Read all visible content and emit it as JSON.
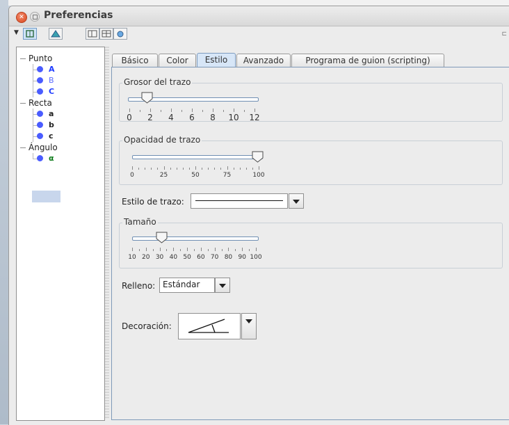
{
  "window": {
    "title": "Preferencias"
  },
  "tree": {
    "groups": [
      {
        "label": "Punto",
        "items": [
          {
            "label": "A",
            "color": "#1f3cff"
          },
          {
            "label": "B",
            "color": "#5b6bff"
          },
          {
            "label": "C",
            "color": "#1f3cff"
          }
        ]
      },
      {
        "label": "Recta",
        "items": [
          {
            "label": "a",
            "color": "#000000"
          },
          {
            "label": "b",
            "color": "#000000"
          },
          {
            "label": "c",
            "color": "#000000"
          }
        ]
      },
      {
        "label": "Ángulo",
        "items": [
          {
            "label": "α",
            "color": "#0a7a18"
          }
        ]
      }
    ],
    "selected": "α"
  },
  "tabs": [
    {
      "label": "Básico"
    },
    {
      "label": "Color"
    },
    {
      "label": "Estilo"
    },
    {
      "label": "Avanzado"
    },
    {
      "label": "Programa de guion (scripting)"
    }
  ],
  "active_tab": "Estilo",
  "style": {
    "thickness": {
      "title": "Grosor del trazo",
      "value": 2,
      "min": 0,
      "max": 12,
      "ticks": [
        "0",
        "2",
        "4",
        "6",
        "8",
        "10",
        "12"
      ]
    },
    "opacity": {
      "title": "Opacidad de trazo",
      "value": 100,
      "min": 0,
      "max": 100,
      "ticks": [
        "0",
        "25",
        "50",
        "75",
        "100"
      ]
    },
    "line_style": {
      "label": "Estilo de trazo:",
      "value": ""
    },
    "size": {
      "title": "Tamaño",
      "value": 30,
      "min": 10,
      "max": 100,
      "ticks": [
        "10",
        "20",
        "30",
        "40",
        "50",
        "60",
        "70",
        "80",
        "90",
        "100"
      ]
    },
    "fill": {
      "label": "Relleno:",
      "value": "Estándar"
    },
    "decoration": {
      "label": "Decoración:",
      "icon": "angle-decoration-icon"
    }
  },
  "colors": {
    "accent": "#4a5cff",
    "tab_active": "#d7e6f7"
  }
}
